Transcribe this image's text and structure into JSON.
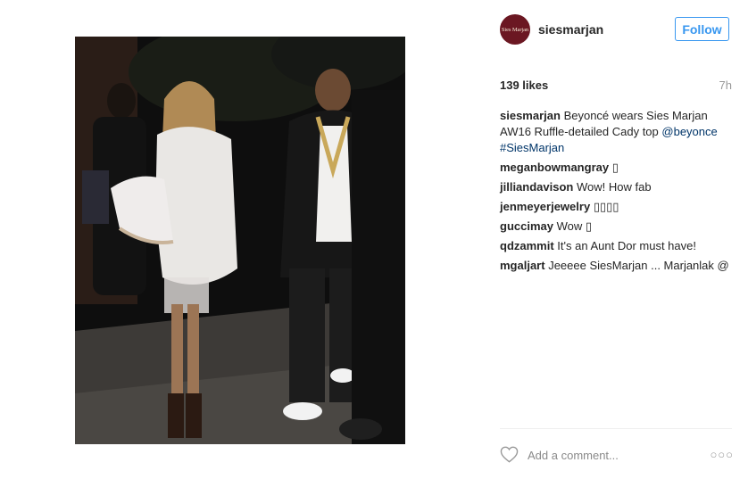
{
  "post": {
    "image_alt": "Beyoncé and Jay-Z walking at night",
    "username": "siesmarjan",
    "avatar_text": "Sies Marjan",
    "follow_label": "Follow",
    "likes": "139 likes",
    "time": "7h",
    "caption": {
      "user": "siesmarjan",
      "text": "Beyoncé wears Sies Marjan AW16 Ruffle-detailed Cady top ",
      "mention": "@beyonce",
      "hashtag": "#SiesMarjan"
    },
    "comments": [
      {
        "user": "meganbowmangray",
        "text": "▯"
      },
      {
        "user": "jilliandavison",
        "text": "Wow! How fab"
      },
      {
        "user": "jenmeyerjewelry",
        "text": "▯▯▯▯"
      },
      {
        "user": "guccimay",
        "text": "Wow ▯"
      },
      {
        "user": "qdzammit",
        "text": "It's an Aunt Dor must have!"
      },
      {
        "user": "mgaljart",
        "text": "Jeeeee SiesMarjan ... Marjanlak @"
      }
    ],
    "add_comment_placeholder": "Add a comment...",
    "more_label": "○○○"
  },
  "colors": {
    "accent": "#3897f0",
    "link": "#003569",
    "avatar_bg": "#6b1722"
  },
  "icons": [
    "heart-icon",
    "more-options-icon"
  ]
}
